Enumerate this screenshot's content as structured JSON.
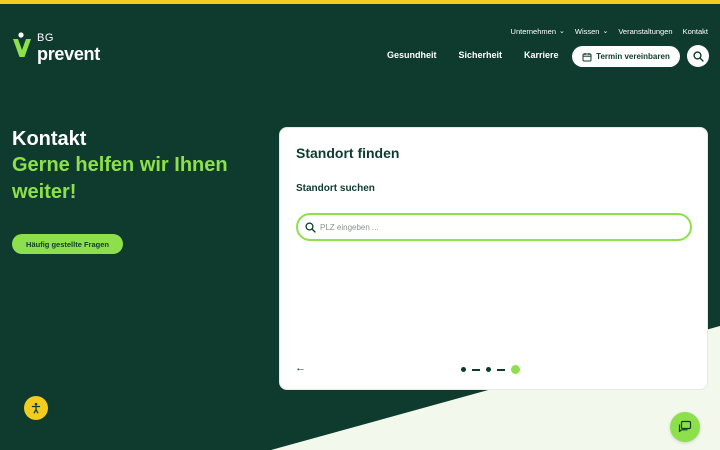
{
  "brand": {
    "logo_top": "BG",
    "logo_bottom": "prevent"
  },
  "utility_nav": [
    {
      "label": "Unternehmen",
      "has_dropdown": true
    },
    {
      "label": "Wissen",
      "has_dropdown": true
    },
    {
      "label": "Veranstaltungen",
      "has_dropdown": false
    },
    {
      "label": "Kontakt",
      "has_dropdown": false
    }
  ],
  "main_nav": [
    {
      "label": "Gesundheit"
    },
    {
      "label": "Sicherheit"
    },
    {
      "label": "Karriere"
    }
  ],
  "cta": {
    "label": "Termin vereinbaren",
    "icon": "calendar-icon"
  },
  "search_icon": "search-icon",
  "hero": {
    "title": "Kontakt",
    "subtitle": "Gerne helfen wir Ihnen weiter!",
    "faq_button": "Häufig gestellte Fragen"
  },
  "locator": {
    "title": "Standort finden",
    "subtitle": "Standort suchen",
    "search": {
      "value": "",
      "placeholder": "PLZ eingeben ..."
    },
    "back_icon": "arrow-left-icon",
    "pager": {
      "count": 5,
      "active_index": 5
    }
  },
  "floating": {
    "accessibility_icon": "accessibility-icon",
    "chat_icon": "chat-icon"
  },
  "colors": {
    "dark_green": "#0f3b2e",
    "accent_green": "#8de04c",
    "yellow": "#f2cc1f",
    "light_bg": "#f2f8ec",
    "white": "#ffffff"
  }
}
